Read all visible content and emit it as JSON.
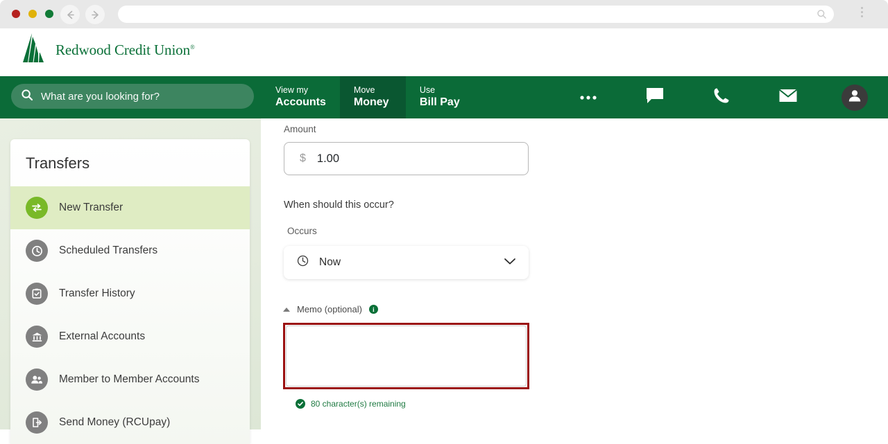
{
  "browser": {
    "url_value": "",
    "url_placeholder": "",
    "back_icon": "back-arrow-icon",
    "forward_icon": "forward-arrow-icon",
    "search_icon": "search-icon",
    "menu_icon": "kebab-menu-icon"
  },
  "brand": {
    "name": "Redwood Credit Union",
    "trademark": "®",
    "logo_icon": "redwood-tree-logo",
    "logo_color": "#0a7038"
  },
  "nav": {
    "search": {
      "placeholder": "What are you looking for?",
      "icon": "search-icon"
    },
    "tabs": [
      {
        "top": "View my",
        "bottom": "Accounts",
        "active": false
      },
      {
        "top": "Move",
        "bottom": "Money",
        "active": true
      },
      {
        "top": "Use",
        "bottom": "Bill Pay",
        "active": false
      }
    ],
    "icons": [
      {
        "name": "more-options-icon",
        "label": "More"
      },
      {
        "name": "chat-icon",
        "label": "Chat"
      },
      {
        "name": "phone-icon",
        "label": "Call"
      },
      {
        "name": "envelope-icon",
        "label": "Messages"
      },
      {
        "name": "user-avatar-icon",
        "label": "Profile"
      }
    ],
    "bar_color": "#0b6b38",
    "active_tab_color": "#0a5731",
    "search_bg_color": "#3d8560"
  },
  "sidebar": {
    "title": "Transfers",
    "items": [
      {
        "label": "New Transfer",
        "icon": "transfer-arrows-icon",
        "active": true
      },
      {
        "label": "Scheduled Transfers",
        "icon": "clock-icon",
        "active": false
      },
      {
        "label": "Transfer History",
        "icon": "clipboard-check-icon",
        "active": false
      },
      {
        "label": "External Accounts",
        "icon": "bank-icon",
        "active": false
      },
      {
        "label": "Member to Member Accounts",
        "icon": "people-icon",
        "active": false
      },
      {
        "label": "Send Money (RCUpay)",
        "icon": "send-money-icon",
        "active": false
      }
    ],
    "active_bg_color": "#dfecc3",
    "active_icon_color": "#79b928",
    "icon_color": "#808080"
  },
  "form": {
    "amount_label": "Amount",
    "amount_currency": "$",
    "amount_value": "1.00",
    "when_question": "When should this occur?",
    "occurs_label": "Occurs",
    "occurs_value": "Now",
    "occurs_icon": "clock-icon",
    "occurs_chevron": "chevron-down-icon",
    "memo_label": "Memo (optional)",
    "memo_info_icon": "info-icon",
    "memo_collapse_icon": "caret-up-icon",
    "memo_value": "",
    "memo_placeholder": "",
    "char_count_text": "80 character(s) remaining",
    "char_count_icon": "check-circle-icon",
    "highlight_color": "#9b1111",
    "success_color": "#0a7038"
  }
}
